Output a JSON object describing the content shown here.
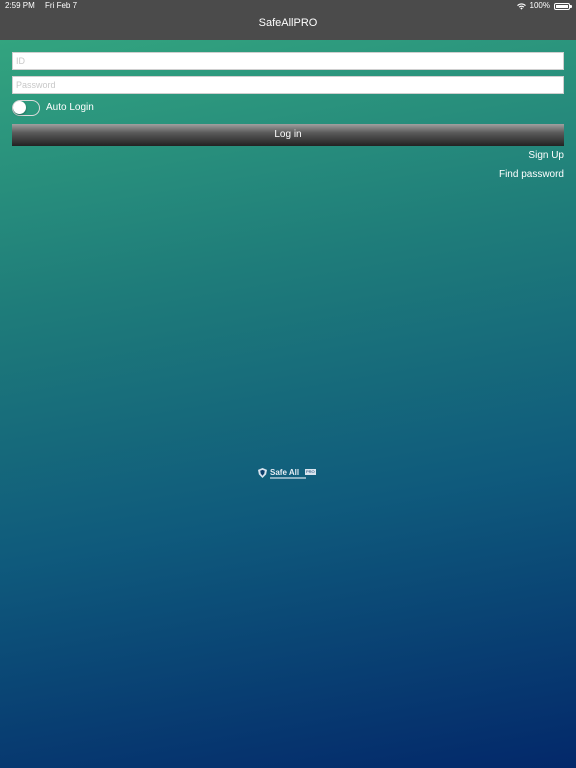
{
  "status_bar": {
    "time": "2:59 PM",
    "date": "Fri Feb 7",
    "battery": "100%",
    "wifi_icon": "wifi-icon",
    "battery_icon": "battery-icon"
  },
  "nav": {
    "title": "SafeAllPRO"
  },
  "login_form": {
    "id_placeholder": "ID",
    "password_placeholder": "Password",
    "auto_login_label": "Auto Login",
    "auto_login_on": false,
    "login_button": "Log in",
    "signup_link": "Sign Up",
    "find_password_link": "Find password"
  },
  "logo": {
    "text": "Safe All",
    "badge": "PRO",
    "icon": "shield-icon"
  },
  "colors": {
    "nav_background": "#4b4b4b",
    "gradient_top": "#36aa80",
    "gradient_bottom": "#03286a"
  }
}
